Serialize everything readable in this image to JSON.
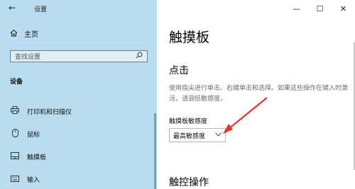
{
  "window": {
    "title": "设置",
    "controls": {
      "minimize": "—",
      "maximize": "☐",
      "close": "✕"
    }
  },
  "sidebar": {
    "back_glyph": "←",
    "home_label": "主页",
    "search_placeholder": "查找设置",
    "section_title": "设备",
    "items": [
      {
        "label": "打印机和扫描仪",
        "icon": "printer-icon"
      },
      {
        "label": "鼠标",
        "icon": "mouse-icon"
      },
      {
        "label": "触摸板",
        "icon": "touchpad-icon",
        "active": true
      },
      {
        "label": "输入",
        "icon": "keyboard-icon"
      }
    ]
  },
  "main": {
    "page_title": "触摸板",
    "group_title": "点击",
    "description": "使用指尖进行单击、右键单击和选择。如果这些操作在键入时激活，请调低敏感度。",
    "field_label": "触摸板敏感度",
    "dropdown_value": "最高敏感度",
    "group_title_2": "触控操作"
  },
  "colors": {
    "sidebar_bg": "#b9dcef",
    "annotation": "#e8332b"
  }
}
